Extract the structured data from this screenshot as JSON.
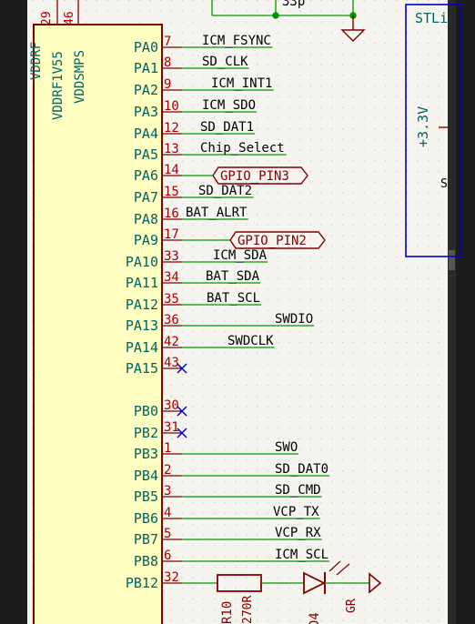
{
  "colors": {
    "background": "#f5f4ef",
    "dot_grid": "#c8c8c8",
    "border": "#1a1a1a",
    "ic_fill": "#ffffc2",
    "ic_outline": "#840000",
    "pin_name": "#006464",
    "pin_number": "#a90000",
    "wire": "#009600",
    "label_text": "#000000",
    "global_label": "#840000",
    "no_connect": "#0000c8",
    "power": "#840000",
    "stlink_box": "#0000c8"
  },
  "ic": {
    "top_pin_numbers": [
      "29",
      "46"
    ],
    "power_pin_names": [
      "VDDRF",
      "VDDRF1V55",
      "VDDSMPS"
    ]
  },
  "pins": [
    {
      "name": "PA0",
      "number": "7",
      "net": "ICM_FSYNC",
      "type": "label"
    },
    {
      "name": "PA1",
      "number": "8",
      "net": "SD_CLK",
      "type": "label"
    },
    {
      "name": "PA2",
      "number": "9",
      "net": "ICM_INT1",
      "type": "label"
    },
    {
      "name": "PA3",
      "number": "10",
      "net": "ICM_SDO",
      "type": "label"
    },
    {
      "name": "PA4",
      "number": "12",
      "net": "SD_DAT1",
      "type": "label"
    },
    {
      "name": "PA5",
      "number": "13",
      "net": "Chip_Select",
      "type": "label"
    },
    {
      "name": "PA6",
      "number": "14",
      "net": "GPIO_PIN3",
      "type": "global"
    },
    {
      "name": "PA7",
      "number": "15",
      "net": "SD_DAT2",
      "type": "label"
    },
    {
      "name": "PA8",
      "number": "16",
      "net": "BAT_ALRT",
      "type": "label"
    },
    {
      "name": "PA9",
      "number": "17",
      "net": "GPIO_PIN2",
      "type": "global"
    },
    {
      "name": "PA10",
      "number": "33",
      "net": "ICM_SDA",
      "type": "label"
    },
    {
      "name": "PA11",
      "number": "34",
      "net": "BAT_SDA",
      "type": "label"
    },
    {
      "name": "PA12",
      "number": "35",
      "net": "BAT_SCL",
      "type": "label"
    },
    {
      "name": "PA13",
      "number": "36",
      "net": "SWDIO",
      "type": "label"
    },
    {
      "name": "PA14",
      "number": "42",
      "net": "SWDCLK",
      "type": "label"
    },
    {
      "name": "PA15",
      "number": "43",
      "net": "",
      "type": "nc"
    },
    {
      "name": "PB0",
      "number": "30",
      "net": "",
      "type": "nc"
    },
    {
      "name": "PB2",
      "number": "31",
      "net": "",
      "type": "nc"
    },
    {
      "name": "PB3",
      "number": "1",
      "net": "SWO",
      "type": "label"
    },
    {
      "name": "PB4",
      "number": "2",
      "net": "SD_DAT0",
      "type": "label"
    },
    {
      "name": "PB5",
      "number": "3",
      "net": "SD_CMD",
      "type": "label"
    },
    {
      "name": "PB6",
      "number": "4",
      "net": "VCP_TX",
      "type": "label"
    },
    {
      "name": "PB7",
      "number": "5",
      "net": "VCP_RX",
      "type": "label"
    },
    {
      "name": "PB8",
      "number": "6",
      "net": "ICM_SCL",
      "type": "label"
    },
    {
      "name": "PB12",
      "number": "32",
      "net": "",
      "type": "led"
    }
  ],
  "top": {
    "partial_label": "33p"
  },
  "stlink": {
    "title_partial": "STLi",
    "power_label": "+3.3V",
    "partial_side_label": "S"
  },
  "led_chain": {
    "resistor_ref": "R10",
    "resistor_value": "270R",
    "led_ref": "D4",
    "led_value": "GR"
  }
}
